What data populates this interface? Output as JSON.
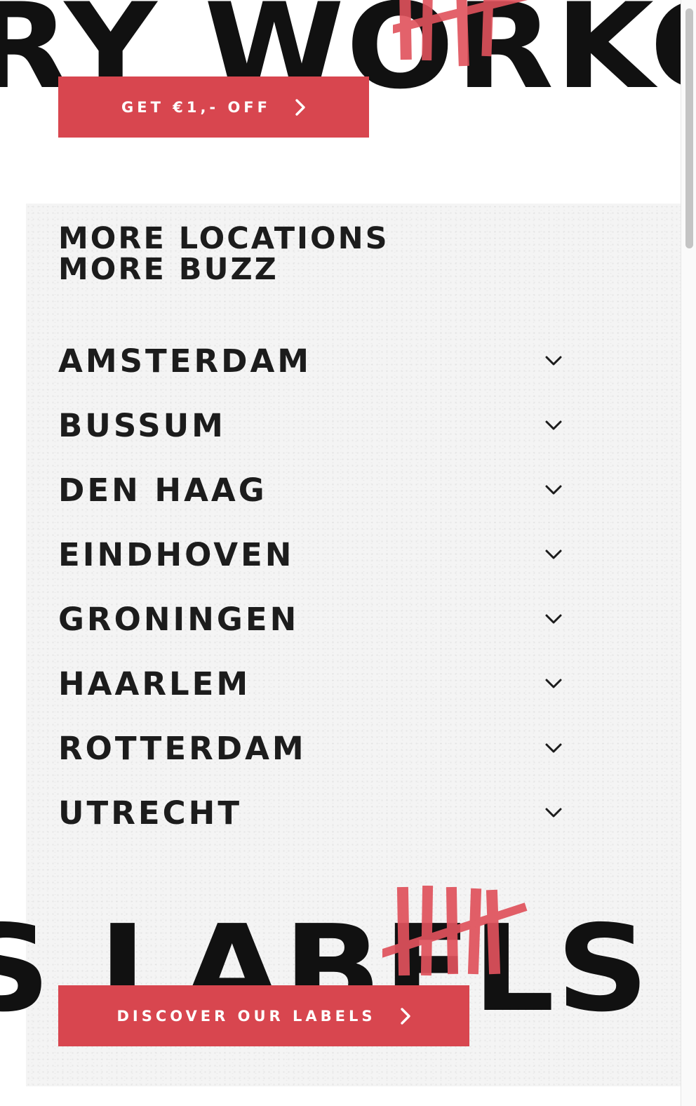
{
  "hero": {
    "headline": "RY WORKOU"
  },
  "offer_cta": {
    "label": "GET €1,- OFF"
  },
  "locations": {
    "heading_line1": "MORE LOCATIONS",
    "heading_line2": "MORE BUZZ",
    "items": [
      {
        "label": "AMSTERDAM"
      },
      {
        "label": "BUSSUM"
      },
      {
        "label": "DEN HAAG"
      },
      {
        "label": "EINDHOVEN"
      },
      {
        "label": "GRONINGEN"
      },
      {
        "label": "HAARLEM"
      },
      {
        "label": "ROTTERDAM"
      },
      {
        "label": "UTRECHT"
      }
    ]
  },
  "labels_section": {
    "headline": "S LABELS"
  },
  "labels_cta": {
    "label": "DISCOVER OUR LABELS"
  },
  "icons": {
    "cta_arrow": "chevron-right-icon",
    "accordion": "chevron-down-icon",
    "tally": "tally-marks-icon"
  },
  "colors": {
    "accent": "#d8464f",
    "text": "#1c1c1c",
    "panel_bg": "#f4f4f4",
    "tally": "#e0525c"
  }
}
